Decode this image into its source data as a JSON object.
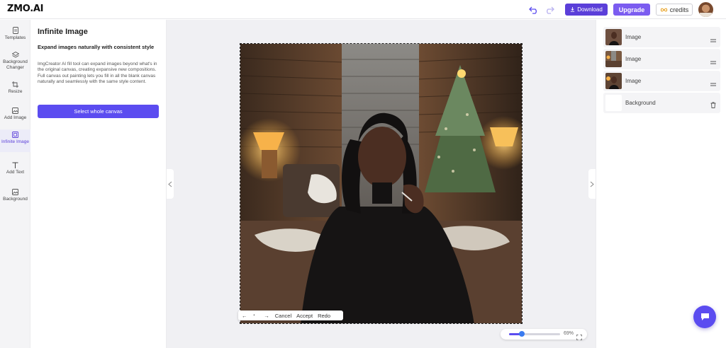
{
  "header": {
    "logo": "ZMO.AI",
    "download_label": "Download",
    "upgrade_label": "Upgrade",
    "credits_label": "credits"
  },
  "rail": {
    "items": [
      {
        "label": "Templates",
        "icon": "templates-icon"
      },
      {
        "label": "Background Changer",
        "icon": "layers-icon"
      },
      {
        "label": "Resize",
        "icon": "crop-icon"
      },
      {
        "label": "Add Image",
        "icon": "image-icon"
      },
      {
        "label": "Infinite Image",
        "icon": "expand-icon"
      },
      {
        "label": "Add Text",
        "icon": "text-icon"
      },
      {
        "label": "Background",
        "icon": "image-icon"
      }
    ]
  },
  "panel": {
    "title": "Infinite Image",
    "subtitle": "Expand images naturally with consistent style",
    "description": "ImgCreator AI fill tool can expand images beyond what's in the original canvas, creating expansive new compositions. Full canvas out painting lets you fill in all the blank canvas naturally and seamlessly with the same style content.",
    "button_label": "Select whole canvas"
  },
  "canvas_toolbar": {
    "prev_symbol": "←",
    "dot_symbol": "•",
    "next_symbol": "→",
    "cancel_label": "Cancel",
    "accept_label": "Accept",
    "redo_label": "Redo"
  },
  "zoom": {
    "percent_label": "69%",
    "level": 0.69
  },
  "layers": [
    {
      "name": "Image"
    },
    {
      "name": "Image"
    },
    {
      "name": "Image"
    },
    {
      "name": "Background"
    }
  ],
  "colors": {
    "accent": "#5b4cf0",
    "download_bg": "#5b3fd9",
    "upgrade_bg": "#7b5cf0"
  }
}
